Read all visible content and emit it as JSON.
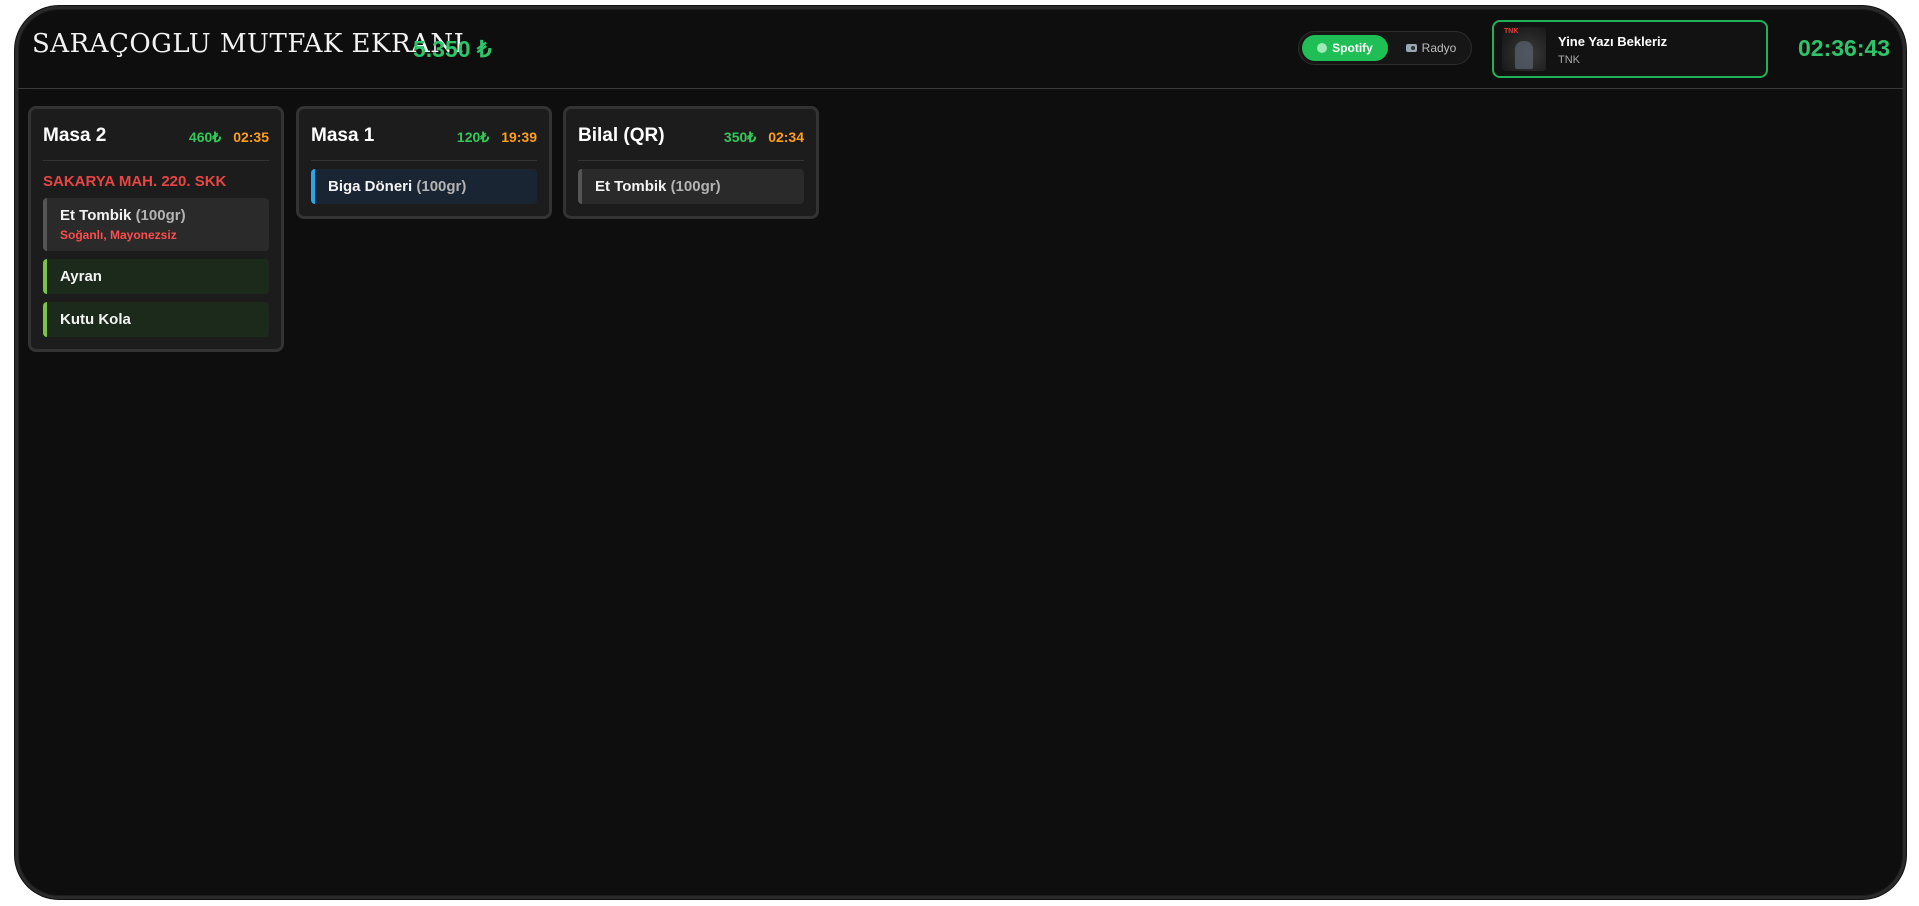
{
  "header": {
    "title": "SARAÇOGLU MUTFAK EKRANI",
    "total": "5.350 ₺",
    "clock": "02:36:43"
  },
  "source_toggle": {
    "spotify_label": "Spotify",
    "radio_label": "Radyo",
    "active": "Spotify"
  },
  "now_playing": {
    "art_tag": "TNK",
    "title": "Yine Yazı Bekleriz",
    "artist": "TNK"
  },
  "orders": [
    {
      "name": "Masa 2",
      "price": "460₺",
      "time": "02:35",
      "address": "SAKARYA MAH. 220. SKK",
      "items": [
        {
          "name": "Et Tombik",
          "portion": "(100gr)",
          "note": "Soğanlı, Mayonezsiz"
        },
        {
          "name": "Ayran"
        },
        {
          "name": "Kutu Kola"
        }
      ]
    },
    {
      "name": "Masa 1",
      "price": "120₺",
      "time": "19:39",
      "items": [
        {
          "name": "Biga Döneri",
          "portion": "(100gr)"
        }
      ]
    },
    {
      "name": "Bilal (QR)",
      "price": "350₺",
      "time": "02:34",
      "items": [
        {
          "name": "Et Tombik",
          "portion": "(100gr)"
        }
      ]
    }
  ],
  "colors": {
    "accent_green": "#2ec46a",
    "time_orange": "#ff9f1a",
    "alert_red": "#e84545",
    "drink_border": "#7cc246",
    "doner_border": "#2aa7e8"
  }
}
